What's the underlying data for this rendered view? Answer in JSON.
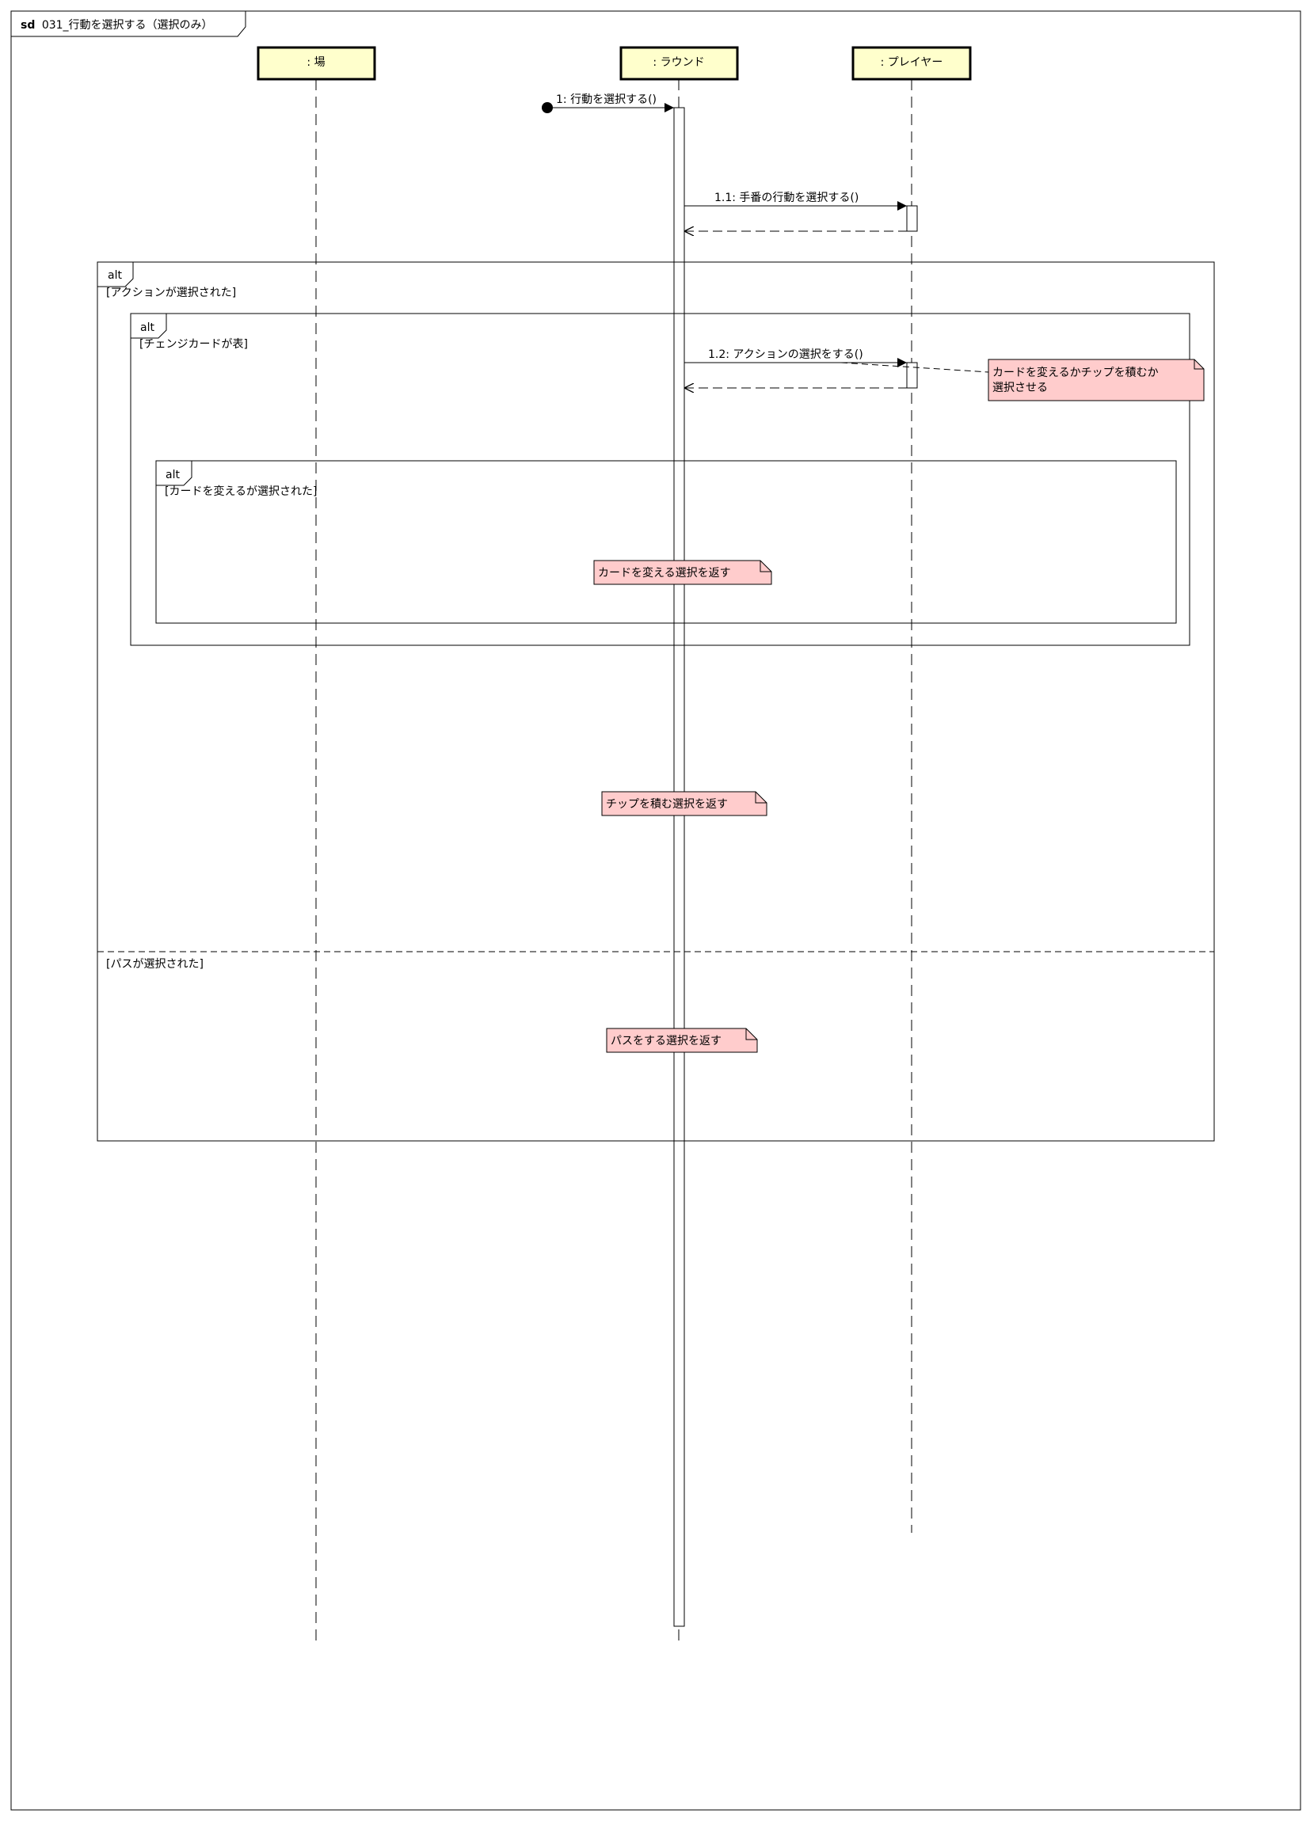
{
  "frame": {
    "keyword": "sd",
    "title": "031_行動を選択する（選択のみ）"
  },
  "lifelines": [
    {
      "id": "ba",
      "label": ": 場"
    },
    {
      "id": "round",
      "label": ": ラウンド"
    },
    {
      "id": "player",
      "label": ": プレイヤー"
    }
  ],
  "messages": [
    {
      "id": "m1",
      "label": "1: 行動を選択する()",
      "kind": "found"
    },
    {
      "id": "m11",
      "label": "1.1: 手番の行動を選択する()",
      "kind": "sync"
    },
    {
      "id": "m11r",
      "label": "",
      "kind": "reply"
    },
    {
      "id": "m12",
      "label": "1.2: アクションの選択をする()",
      "kind": "sync"
    },
    {
      "id": "m12r",
      "label": "",
      "kind": "reply"
    }
  ],
  "fragments": [
    {
      "id": "alt1",
      "operator": "alt",
      "guards": [
        "[アクションが選択された]",
        "[パスが選択された]"
      ]
    },
    {
      "id": "alt2",
      "operator": "alt",
      "guards": [
        "[チェンジカードが表]"
      ]
    },
    {
      "id": "alt3",
      "operator": "alt",
      "guards": [
        "[カードを変えるが選択された]"
      ]
    }
  ],
  "notes": [
    {
      "id": "n1",
      "lines": [
        "カードを変えるかチップを積むか",
        "選択させる"
      ]
    },
    {
      "id": "n2",
      "lines": [
        "カードを変える選択を返す"
      ]
    },
    {
      "id": "n3",
      "lines": [
        "チップを積む選択を返す"
      ]
    },
    {
      "id": "n4",
      "lines": [
        "パスをする選択を返す"
      ]
    }
  ],
  "colors": {
    "lifeline_head_fill": "#ffffcc",
    "note_fill": "#ffcccc",
    "line": "#000000"
  }
}
